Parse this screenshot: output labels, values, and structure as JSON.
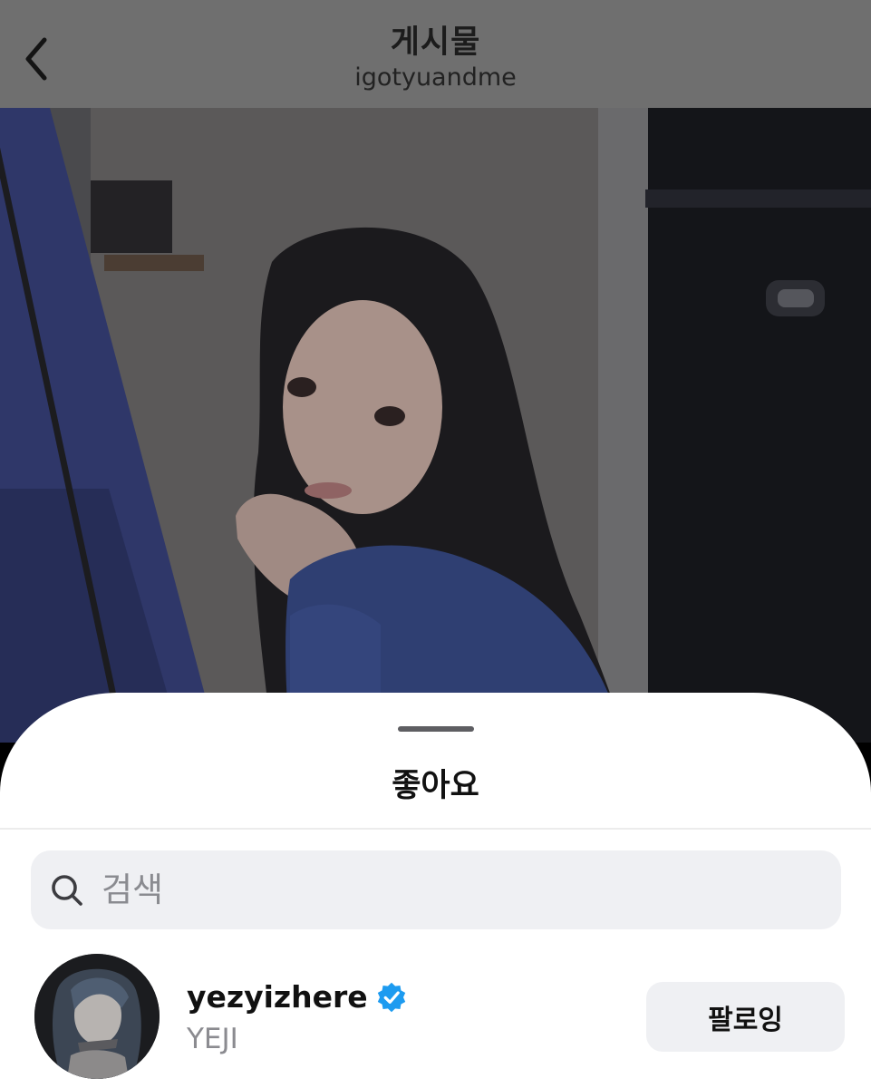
{
  "nav": {
    "title": "게시물",
    "subtitle": "igotyuandme",
    "back_icon": "chevron-left-icon"
  },
  "sheet": {
    "title": "좋아요",
    "search": {
      "placeholder": "검색",
      "value": "",
      "icon": "search-icon"
    },
    "likes": [
      {
        "username": "yezyizhere",
        "verified": true,
        "full_name": "YEJI",
        "follow_label": "팔로잉"
      }
    ]
  },
  "colors": {
    "verified_badge": "#1d9bf0",
    "sheet_background": "#ffffff",
    "search_background": "#eff0f3",
    "button_background": "#eff0f3"
  }
}
